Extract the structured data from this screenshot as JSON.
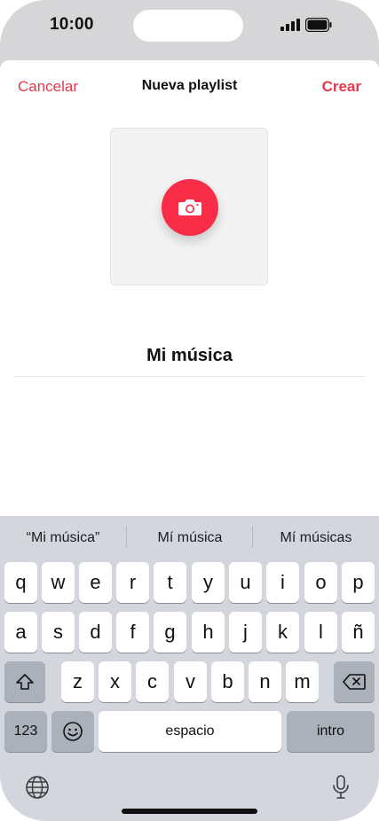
{
  "status": {
    "time": "10:00"
  },
  "nav": {
    "cancel": "Cancelar",
    "title": "Nueva playlist",
    "create": "Crear"
  },
  "playlist": {
    "name": "Mi música"
  },
  "suggestions": [
    "“Mi música”",
    "Mí música",
    "Mí músicas"
  ],
  "keyboard": {
    "row1": [
      "q",
      "w",
      "e",
      "r",
      "t",
      "y",
      "u",
      "i",
      "o",
      "p"
    ],
    "row2": [
      "a",
      "s",
      "d",
      "f",
      "g",
      "h",
      "j",
      "k",
      "l",
      "ñ"
    ],
    "row3": [
      "z",
      "x",
      "c",
      "v",
      "b",
      "n",
      "m"
    ],
    "numbers": "123",
    "space": "espacio",
    "return": "intro"
  },
  "colors": {
    "accent": "#e5384b",
    "camera": "#fa2d48"
  },
  "icons": {
    "camera": "camera-icon",
    "shift": "shift-icon",
    "delete": "delete-icon",
    "emoji": "emoji-icon",
    "globe": "globe-icon",
    "mic": "microphone-icon"
  }
}
